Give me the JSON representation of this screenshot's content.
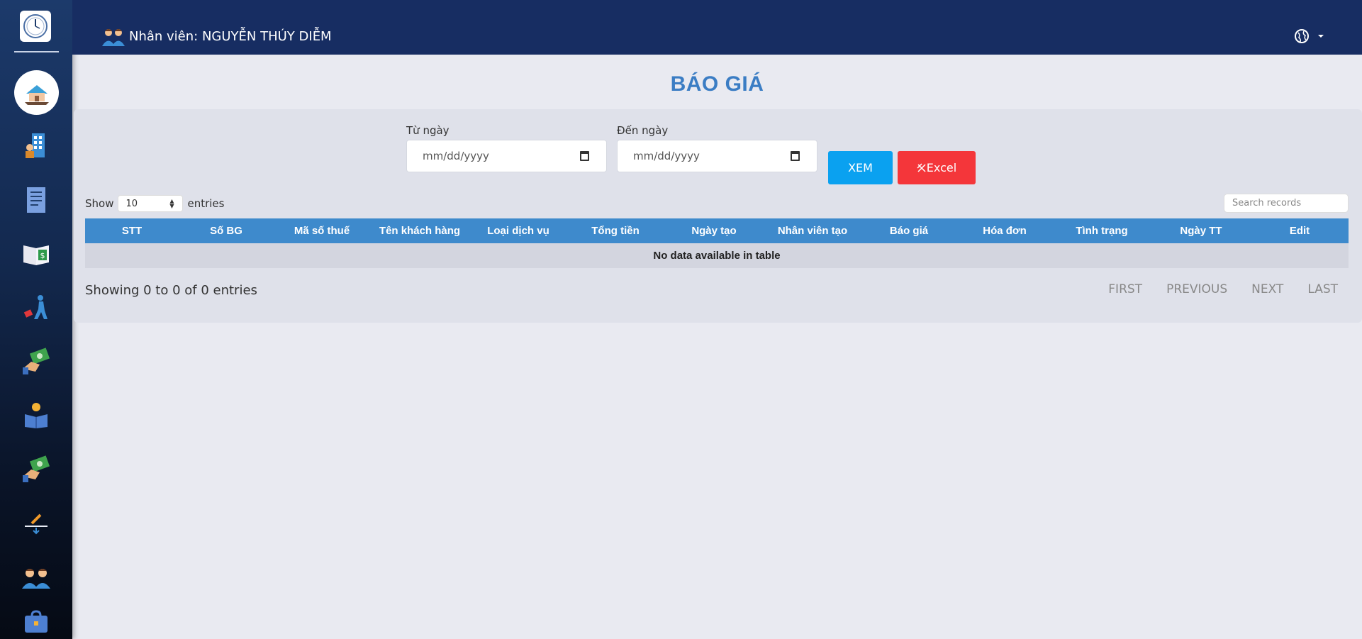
{
  "header": {
    "user_label": "Nhân viên: NGUYỄN THÚY DIỄM"
  },
  "page": {
    "title": "BÁO GIÁ"
  },
  "filters": {
    "from_label": "Từ ngày",
    "from_value": "mm/dd/yyyy",
    "to_label": "Đến ngày",
    "to_value": "mm/dd/yyyy",
    "view_button": "XEM",
    "excel_button": "Excel"
  },
  "table": {
    "show_label": "Show",
    "page_size": "10",
    "entries_label": "entries",
    "search_placeholder": "Search records",
    "columns": [
      "STT",
      "Số BG",
      "Mã số thuế",
      "Tên khách hàng",
      "Loại dịch vụ",
      "Tổng tiền",
      "Ngày tạo",
      "Nhân viên tạo",
      "Báo giá",
      "Hóa đơn",
      "Tình trạng",
      "Ngày TT",
      "Edit"
    ],
    "empty_message": "No data available in table",
    "info": "Showing 0 to 0 of 0 entries",
    "pagination": {
      "first": "FIRST",
      "previous": "PREVIOUS",
      "next": "NEXT",
      "last": "LAST"
    }
  },
  "sidebar": {
    "items": [
      "home-icon",
      "building-icon",
      "document-icon",
      "price-book-icon",
      "staff-walk-icon",
      "money-hand-icon",
      "reader-icon",
      "payment-icon",
      "signature-icon",
      "users-icon",
      "toolbox-icon"
    ]
  },
  "colors": {
    "header_bg": "#172d62",
    "title": "#3b7dc4",
    "table_header": "#3e8acc",
    "xem_button": "#0aa1f0",
    "excel_button": "#f4363a"
  }
}
